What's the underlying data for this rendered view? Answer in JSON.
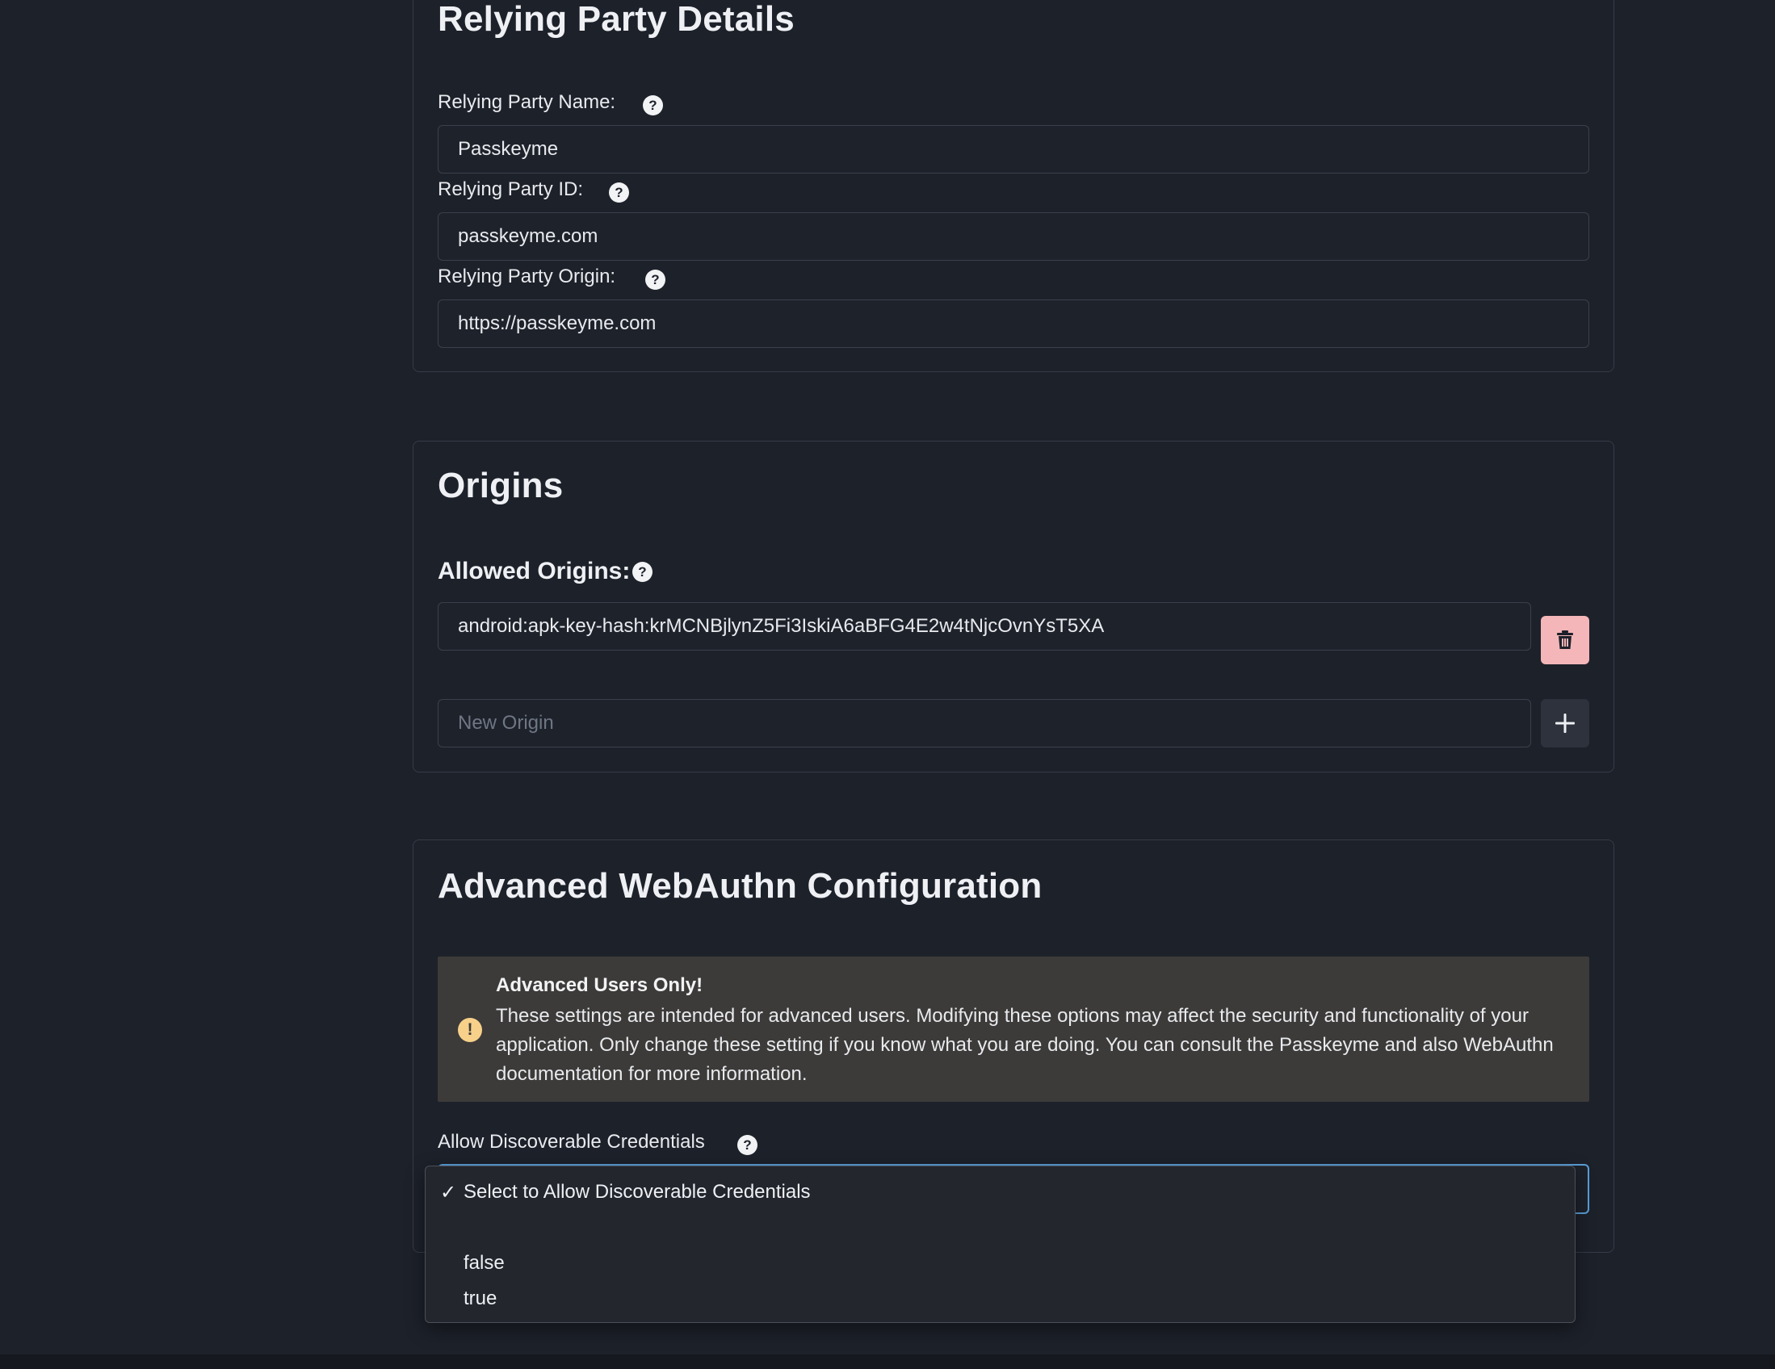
{
  "relying_party": {
    "title": "Relying Party Details",
    "name_label": "Relying Party Name:",
    "name_value": "Passkeyme",
    "id_label": "Relying Party ID:",
    "id_value": "passkeyme.com",
    "origin_label": "Relying Party Origin:",
    "origin_value": "https://passkeyme.com",
    "help_glyph": "?"
  },
  "origins": {
    "title": "Origins",
    "allowed_label": "Allowed Origins:",
    "items": [
      "android:apk-key-hash:krMCNBjlynZ5Fi3IskiA6aBFG4E2w4tNjcOvnYsT5XA"
    ],
    "new_placeholder": "New Origin",
    "delete_icon": "trash-icon",
    "add_icon": "plus-icon"
  },
  "advanced": {
    "title": "Advanced WebAuthn Configuration",
    "warning": {
      "icon": "exclamation-icon",
      "title": "Advanced Users Only!",
      "body": "These settings are intended for advanced users. Modifying these options may affect the security and functionality of your application. Only change these setting if you know what you are doing. You can consult the Passkeyme and also WebAuthn documentation for more information."
    },
    "discoverable_label": "Allow Discoverable Credentials",
    "dropdown": {
      "check_glyph": "✓",
      "options": [
        "Select to Allow Discoverable Credentials",
        "false",
        "true"
      ],
      "selected_index": 0
    }
  },
  "colors": {
    "background": "#1d212a",
    "card_border": "#353b47",
    "delete_button": "#f4b6b8",
    "warning_bg": "#3d3b39",
    "warning_icon": "#f7d18a",
    "focus_border": "#5a9fd8"
  }
}
